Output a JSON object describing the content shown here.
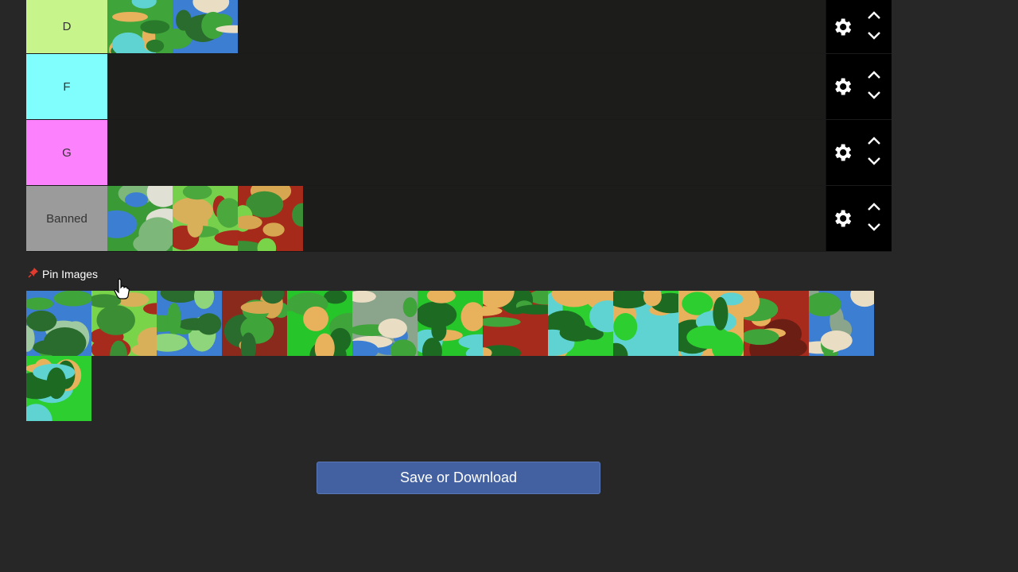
{
  "tiers": [
    {
      "label": "D",
      "color": "#c7f58c",
      "maps": [
        {
          "name": "map-island-center",
          "palette": [
            "#3fa43a",
            "#e8b25c",
            "#2a7a2c",
            "#5ed3d2"
          ]
        },
        {
          "name": "map-river-arc",
          "palette": [
            "#3c7ed1",
            "#3fa43a",
            "#e9ddc4",
            "#2a6b2e"
          ]
        }
      ]
    },
    {
      "label": "F",
      "color": "#80fdfd",
      "maps": []
    },
    {
      "label": "G",
      "color": "#fc81fc",
      "maps": []
    },
    {
      "label": "Banned",
      "color": "#9b9b9b",
      "maps": [
        {
          "name": "map-lake-ring",
          "palette": [
            "#3a9a35",
            "#e0e0d4",
            "#3c7ed1",
            "#7db87a"
          ]
        },
        {
          "name": "map-red-pools",
          "palette": [
            "#77d04c",
            "#a72b1c",
            "#d8b05a",
            "#4aa83d"
          ]
        },
        {
          "name": "map-red-swamp",
          "palette": [
            "#a52a1a",
            "#7ad44a",
            "#d6a650",
            "#3b8e33"
          ]
        }
      ]
    }
  ],
  "pool_label": "Pin Images",
  "pool": [
    {
      "name": "map-blue-cross",
      "palette": [
        "#3c7ed1",
        "#3fa43a",
        "#9fc9a0",
        "#2a6b2e"
      ]
    },
    {
      "name": "map-red-eye",
      "palette": [
        "#7ad44a",
        "#a72b1c",
        "#d8b05a",
        "#3b8e33"
      ]
    },
    {
      "name": "map-blue-heart",
      "palette": [
        "#3c7ed1",
        "#3fa43a",
        "#8fd57b",
        "#2a6b2e"
      ]
    },
    {
      "name": "map-red-x",
      "palette": [
        "#8a2a1c",
        "#3fa43a",
        "#d6a650",
        "#2a6b2e"
      ]
    },
    {
      "name": "map-green-forest",
      "palette": [
        "#26c52a",
        "#1d6b23",
        "#e8b25c",
        "#3fa43a"
      ]
    },
    {
      "name": "map-grey-islands",
      "palette": [
        "#8aa58c",
        "#3c7ed1",
        "#3fa43a",
        "#e9ddc4"
      ]
    },
    {
      "name": "map-cyan-lake",
      "palette": [
        "#26c52a",
        "#e8b25c",
        "#5ed3d2",
        "#1d6b23"
      ]
    },
    {
      "name": "map-red-streaks",
      "palette": [
        "#a72b1c",
        "#3fa43a",
        "#e8b25c",
        "#1d6b23"
      ]
    },
    {
      "name": "map-cyan-channels",
      "palette": [
        "#2ccf2f",
        "#5ed3d2",
        "#e8b25c",
        "#1d6b23"
      ]
    },
    {
      "name": "map-cyan-bay",
      "palette": [
        "#5ed3d2",
        "#2ccf2f",
        "#e8b25c",
        "#1d6b23"
      ]
    },
    {
      "name": "map-sand-ring",
      "palette": [
        "#e8b25c",
        "#2ccf2f",
        "#5ed3d2",
        "#1d6b23"
      ]
    },
    {
      "name": "map-red-crater",
      "palette": [
        "#a72b1c",
        "#6b1e14",
        "#e8b25c",
        "#3fa43a"
      ]
    },
    {
      "name": "map-blue-coast",
      "palette": [
        "#3c7ed1",
        "#8aa58c",
        "#3fa43a",
        "#e9ddc4"
      ]
    },
    {
      "name": "map-cyan-river",
      "palette": [
        "#2ccf2f",
        "#e8b25c",
        "#5ed3d2",
        "#1d6b23"
      ]
    }
  ],
  "save_label": "Save or Download"
}
